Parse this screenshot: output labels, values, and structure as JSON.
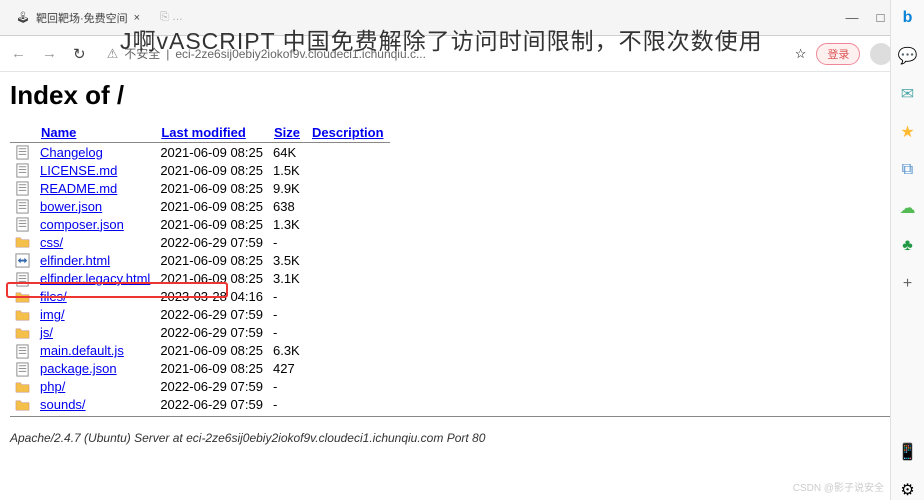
{
  "window": {
    "tab1_icon_color": "#555",
    "tab1_title": "靶回靶场·免费空间",
    "minimize": "—",
    "maximize": "□",
    "close": "×"
  },
  "addr": {
    "insecure_label": "不安全",
    "url_display": "eci-2ze6sij0ebiy2iokof9v.cloudeci1.ichunqiu.c...",
    "star": "☆",
    "login": "登录",
    "dots": "•••"
  },
  "overlay": "J啊vASCRIPT 中国免费解除了访问时间限制，不限次数使用",
  "page": {
    "title": "Index of /",
    "columns": {
      "name": "Name",
      "modified": "Last modified",
      "size": "Size",
      "desc": "Description"
    },
    "rows": [
      {
        "icon": "text",
        "name": "Changelog",
        "modified": "2021-06-09 08:25",
        "size": "64K"
      },
      {
        "icon": "text",
        "name": "LICENSE.md",
        "modified": "2021-06-09 08:25",
        "size": "1.5K"
      },
      {
        "icon": "text",
        "name": "README.md",
        "modified": "2021-06-09 08:25",
        "size": "9.9K"
      },
      {
        "icon": "text",
        "name": "bower.json",
        "modified": "2021-06-09 08:25",
        "size": "638"
      },
      {
        "icon": "text",
        "name": "composer.json",
        "modified": "2021-06-09 08:25",
        "size": "1.3K"
      },
      {
        "icon": "folder",
        "name": "css/",
        "modified": "2022-06-29 07:59",
        "size": "-"
      },
      {
        "icon": "html",
        "name": "elfinder.html",
        "modified": "2021-06-09 08:25",
        "size": "3.5K",
        "highlight": true
      },
      {
        "icon": "text",
        "name": "elfinder.legacy.html",
        "modified": "2021-06-09 08:25",
        "size": "3.1K"
      },
      {
        "icon": "folder",
        "name": "files/",
        "modified": "2023-03-28 04:16",
        "size": "-"
      },
      {
        "icon": "folder",
        "name": "img/",
        "modified": "2022-06-29 07:59",
        "size": "-"
      },
      {
        "icon": "folder",
        "name": "js/",
        "modified": "2022-06-29 07:59",
        "size": "-"
      },
      {
        "icon": "text",
        "name": "main.default.js",
        "modified": "2021-06-09 08:25",
        "size": "6.3K"
      },
      {
        "icon": "text",
        "name": "package.json",
        "modified": "2021-06-09 08:25",
        "size": "427"
      },
      {
        "icon": "folder",
        "name": "php/",
        "modified": "2022-06-29 07:59",
        "size": "-"
      },
      {
        "icon": "folder",
        "name": "sounds/",
        "modified": "2022-06-29 07:59",
        "size": "-"
      }
    ],
    "footer": "Apache/2.4.7 (Ubuntu) Server at eci-2ze6sij0ebiy2iokof9v.cloudeci1.ichunqiu.com Port 80"
  },
  "sidebar": {
    "bing": "b",
    "chat": "💬",
    "mail": "✉",
    "star": "★",
    "collect": "⧉",
    "cloud": "☁",
    "tree": "♣",
    "plus": "+",
    "mobile": "📱",
    "settings": "⚙"
  },
  "watermark": "CSDN @影子说安全"
}
